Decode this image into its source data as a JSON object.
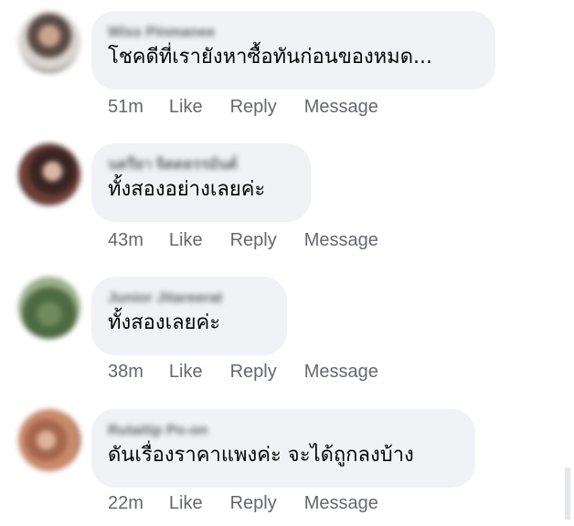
{
  "comments": [
    {
      "author": "Wiss Pinmanee",
      "text": "โชคดีที่เรายังหาซื้อทันก่อนของหมด...",
      "time": "51m",
      "like_label": "Like",
      "reply_label": "Reply",
      "message_label": "Message"
    },
    {
      "author": "นตรียา จิตตธรรมันต์",
      "text": "ทั้งสองอย่างเลยค่ะ",
      "time": "43m",
      "like_label": "Like",
      "reply_label": "Reply",
      "message_label": "Message"
    },
    {
      "author": "Junior Jitareerat",
      "text": "ทั้งสองเลยค่ะ",
      "time": "38m",
      "like_label": "Like",
      "reply_label": "Reply",
      "message_label": "Message"
    },
    {
      "author": "Rutaitip Po-on",
      "text": "ดันเรื่องราคาแพงค่ะ จะได้ถูกลงบ้าง",
      "time": "22m",
      "like_label": "Like",
      "reply_label": "Reply",
      "message_label": "Message"
    }
  ],
  "colors": {
    "bubble_bg": "#f0f2f5",
    "meta_text": "#65676b",
    "body_text": "#050505"
  }
}
